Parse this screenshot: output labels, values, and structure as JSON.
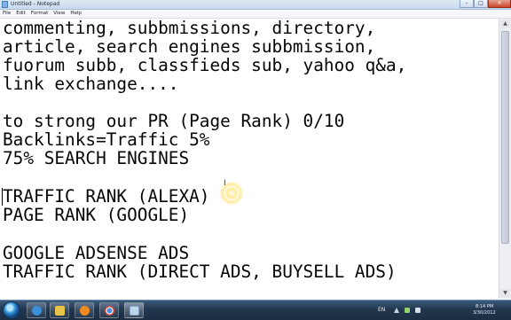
{
  "window": {
    "title": "Untitled - Notepad",
    "controls": {
      "minimize": "–",
      "maximize": "□",
      "close": "✕"
    }
  },
  "menu": [
    "File",
    "Edit",
    "Format",
    "View",
    "Help"
  ],
  "document": {
    "lines": [
      "commenting, subbmissions, directory,",
      "article, search engines subbmission,",
      "fuorum subb, classfieds sub, yahoo q&a,",
      "link exchange....",
      "",
      "to strong our PR (Page Rank) 0/10",
      "Backlinks=Traffic 5%",
      "75% SEARCH ENGINES",
      "",
      "TRAFFIC RANK (ALEXA)",
      "PAGE RANK (GOOGLE)",
      "",
      "GOOGLE ADSENSE ADS",
      "TRAFFIC RANK (DIRECT ADS, BUYSELL ADS)"
    ]
  },
  "scrollbar": {
    "up_arrow": "▲",
    "down_arrow": "▼"
  },
  "taskbar": {
    "pinned": [
      {
        "name": "internet-explorer",
        "color": "#3a8fd6"
      },
      {
        "name": "windows-explorer",
        "color": "#e8c34a"
      },
      {
        "name": "media-player",
        "color": "#f08a1e"
      },
      {
        "name": "chrome",
        "color": "#d9453a"
      },
      {
        "name": "notepad",
        "color": "#bcd6ee"
      }
    ],
    "language": "EN",
    "time": "8:14 PM",
    "date": "3/30/2012"
  }
}
